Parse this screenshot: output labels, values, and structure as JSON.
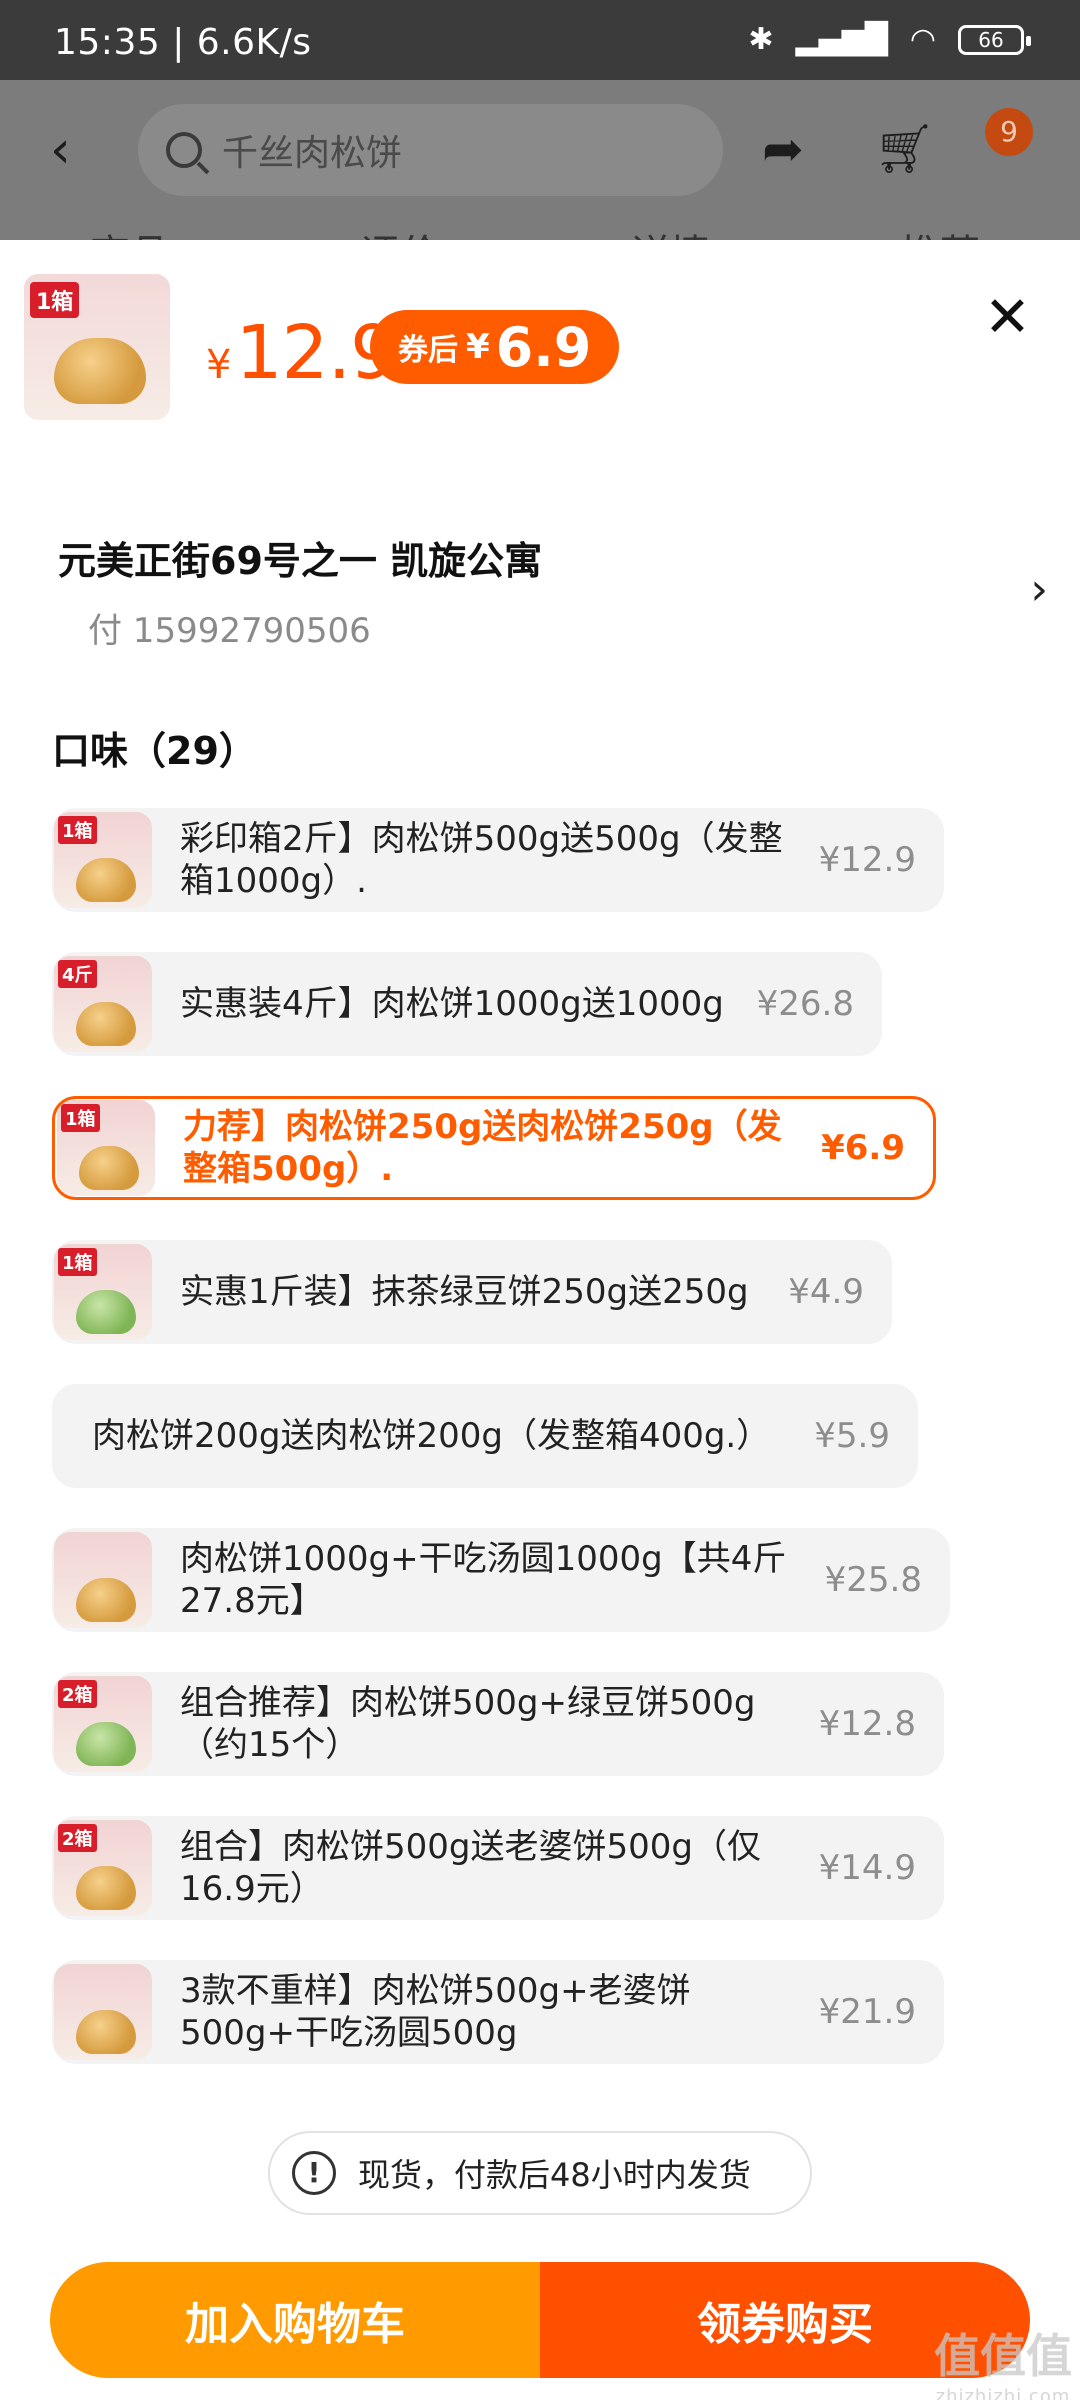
{
  "status_bar": {
    "time_speed": "15:35 | 6.6K/s",
    "battery": "66"
  },
  "header": {
    "search_placeholder": "千丝肉松饼",
    "cart_badge": "9",
    "tabs_peek": [
      "商品",
      "评价",
      "详情",
      "推荐"
    ]
  },
  "product": {
    "thumb_tag": "1箱",
    "price_symbol": "¥",
    "price": "12.9",
    "coupon_label": "券后",
    "coupon_symbol": "¥",
    "coupon_price": "6.9"
  },
  "address": {
    "line": "元美正街69号之一 凯旋公寓",
    "phone": "付 15992790506"
  },
  "section": {
    "title": "口味（29）"
  },
  "options": [
    {
      "text": "彩印箱2斤】肉松饼500g送500g（发整箱1000g）.",
      "price": "¥12.9",
      "tag": "1箱"
    },
    {
      "text": "实惠装4斤】肉松饼1000g送1000g",
      "price": "¥26.8",
      "tag": "4斤"
    },
    {
      "text": "力荐】肉松饼250g送肉松饼250g（发整箱500g）.",
      "price": "¥6.9",
      "tag": "1箱"
    },
    {
      "text": "实惠1斤装】抹茶绿豆饼250g送250g",
      "price": "¥4.9",
      "tag": "1箱"
    },
    {
      "text": "肉松饼200g送肉松饼200g（发整箱400g.）",
      "price": "¥5.9"
    },
    {
      "text": "肉松饼1000g+干吃汤圆1000g【共4斤27.8元】",
      "price": "¥25.8"
    },
    {
      "text": "组合推荐】肉松饼500g+绿豆饼500g（约15个）",
      "price": "¥12.8",
      "tag": "2箱"
    },
    {
      "text": "组合】肉松饼500g送老婆饼500g（仅16.9元）",
      "price": "¥14.9",
      "tag": "2箱"
    },
    {
      "text": "3款不重样】肉松饼500g+老婆饼500g+干吃汤圆500g",
      "price": "¥21.9"
    }
  ],
  "notice": {
    "icon_text": "!",
    "text": "现货，付款后48小时内发货"
  },
  "buttons": {
    "add_cart": "加入购物车",
    "buy": "领券购买"
  },
  "watermark": {
    "main": "值值值",
    "sub": "zhizhizhi.com"
  }
}
